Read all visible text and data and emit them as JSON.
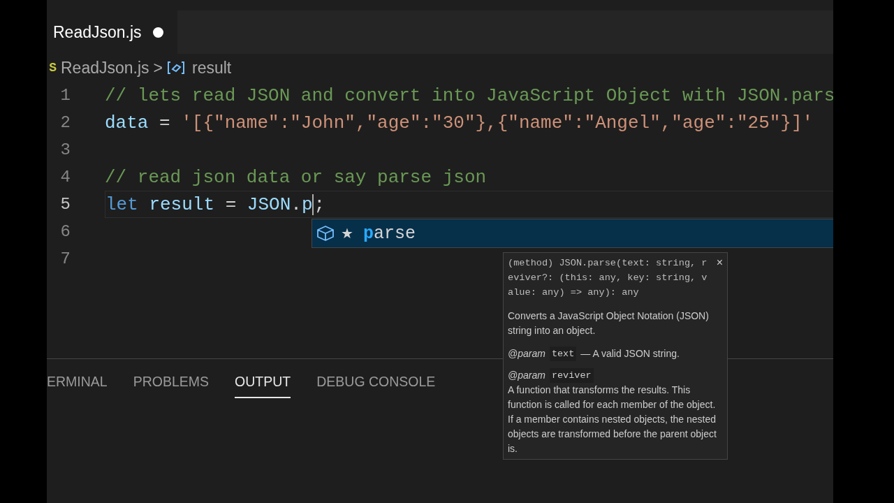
{
  "tabs": [
    {
      "label": "ReadJson.js",
      "modified": true,
      "selected": true
    }
  ],
  "breadcrumb": {
    "file_icon": "S",
    "file": "ReadJson.js",
    "separator": ">",
    "symbol": "result"
  },
  "editor": {
    "lines": [
      {
        "number": "1",
        "current": false,
        "tokens": [
          {
            "text": "// lets read JSON and convert into JavaScript Object with JSON.pars",
            "kind": "comment"
          }
        ]
      },
      {
        "number": "2",
        "current": false,
        "tokens": [
          {
            "text": "data",
            "kind": "variable"
          },
          {
            "text": " = ",
            "kind": "plain"
          },
          {
            "text": "'[{\"name\":\"John\",\"age\":\"30\"},{\"name\":\"Angel\",\"age\":\"25\"}]'",
            "kind": "string"
          }
        ]
      },
      {
        "number": "3",
        "current": false
      },
      {
        "number": "4",
        "current": false,
        "tokens": [
          {
            "text": "// read json data or say parse json",
            "kind": "comment"
          }
        ]
      },
      {
        "number": "5",
        "current": true,
        "tokens": [
          {
            "text": "let",
            "kind": "keyword",
            "space_after": true
          },
          {
            "text": "result",
            "kind": "variable"
          },
          {
            "text": " = ",
            "kind": "plain"
          },
          {
            "text": "JSON",
            "kind": "variable"
          },
          {
            "text": ".",
            "kind": "plain"
          },
          {
            "text": "p",
            "kind": "variable",
            "caret_after": true
          },
          {
            "text": ";",
            "kind": "plain"
          }
        ]
      },
      {
        "number": "6",
        "current": false
      },
      {
        "number": "7",
        "current": false
      }
    ]
  },
  "suggestions": [
    {
      "star": "★",
      "match": "p",
      "rest": "arse",
      "selected": true
    }
  ],
  "hover": {
    "close": "×",
    "signature_lines": [
      "(method) JSON.parse(text: string, r",
      "eviver?: (this: any, key: string, v",
      "alue: any) => any): any"
    ],
    "description": "Converts a JavaScript Object Notation (JSON) string into an object.",
    "params": [
      {
        "tag": "@param",
        "name": "text",
        "description": "— A valid JSON string.",
        "kind": "inline"
      },
      {
        "tag": "@param",
        "name": "reviver",
        "description": "A function that transforms the results. This function is called for each member of the object. If a member contains nested objects, the nested objects are transformed before the parent object is.",
        "kind": "block"
      }
    ]
  },
  "panel": {
    "tabs": [
      {
        "label": "ERMINAL",
        "selected": false
      },
      {
        "label": "PROBLEMS",
        "selected": false
      },
      {
        "label": "OUTPUT",
        "selected": true
      },
      {
        "label": "DEBUG CONSOLE",
        "selected": false
      }
    ]
  }
}
